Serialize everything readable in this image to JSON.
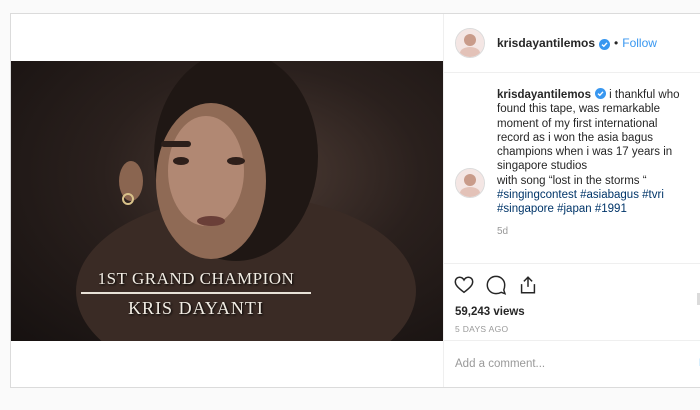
{
  "post": {
    "username": "krisdayantilemos",
    "separator": "•",
    "follow_label": "Follow",
    "overlay": {
      "title": "1ST GRAND CHAMPION",
      "name": "KRIS DAYANTI"
    },
    "caption": {
      "username": "krisdayantilemos",
      "text": "i thankful who found this tape, was remarkable moment of my first international record as i won the asia bagus champions when i was 17 years in singapore studios",
      "song_line": "with song “lost in the storms “",
      "hashtags": [
        "#singingcontest",
        "#asiabagus",
        "#tvri",
        "#singapore",
        "#japan",
        "#1991"
      ],
      "age": "5d"
    },
    "icons": {
      "like": "heart-icon",
      "comment": "comment-icon",
      "share": "share-icon",
      "verified": "verified-badge-icon"
    },
    "views": "59,243 views",
    "posted_ago": "5 DAYS AGO",
    "add_comment_placeholder": "Add a comment...",
    "post_label": "P",
    "colors": {
      "link": "#3897f0",
      "hashtag": "#003569",
      "muted": "#999999"
    }
  }
}
